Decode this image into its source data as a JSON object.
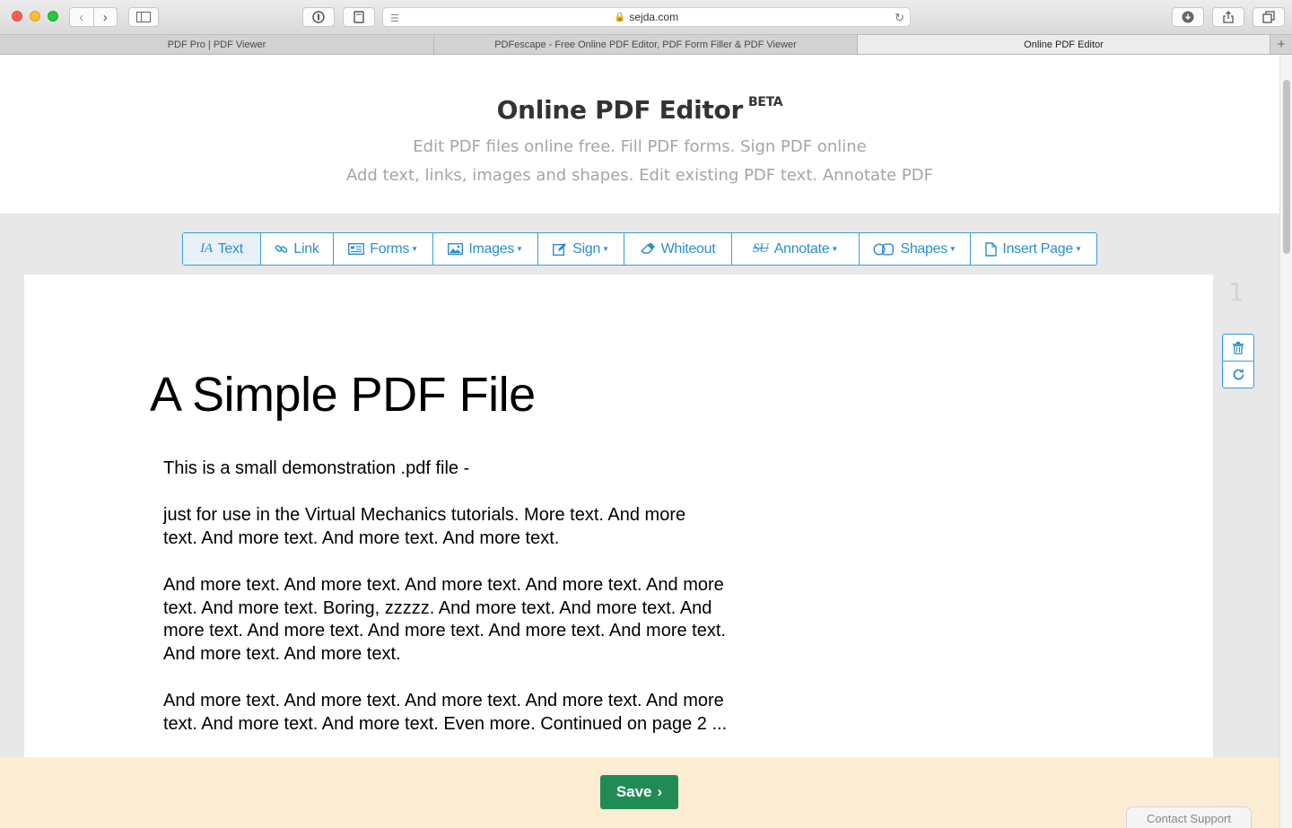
{
  "browser": {
    "url": "sejda.com",
    "tabs": [
      {
        "title": "PDF Pro | PDF Viewer",
        "active": false
      },
      {
        "title": "PDFescape - Free Online PDF Editor, PDF Form Filler & PDF Viewer",
        "active": false
      },
      {
        "title": "Online PDF Editor",
        "active": true
      }
    ]
  },
  "header": {
    "title": "Online PDF Editor",
    "badge": "BETA",
    "subtitle_line1": "Edit PDF files online free. Fill PDF forms. Sign PDF online",
    "subtitle_line2": "Add text, links, images and shapes. Edit existing PDF text. Annotate PDF"
  },
  "toolbar": {
    "text": "Text",
    "link": "Link",
    "forms": "Forms",
    "images": "Images",
    "sign": "Sign",
    "whiteout": "Whiteout",
    "annotate": "Annotate",
    "shapes": "Shapes",
    "insert_page": "Insert Page"
  },
  "document": {
    "page_number": "1",
    "title": "A Simple PDF File",
    "lines": [
      "This is a small demonstration .pdf file -",
      "just for use in the Virtual Mechanics tutorials. More text. And more",
      "text. And more text. And more text. And more text.",
      "And more text. And more text. And more text. And more text. And more",
      "text. And more text. Boring, zzzzz. And more text. And more text. And",
      "more text. And more text. And more text. And more text. And more text.",
      "And more text. And more text.",
      "And more text. And more text. And more text. And more text. And more",
      "text. And more text. And more text. Even more. Continued on page 2 ..."
    ]
  },
  "footer": {
    "save": "Save",
    "contact_support": "Contact Support"
  }
}
